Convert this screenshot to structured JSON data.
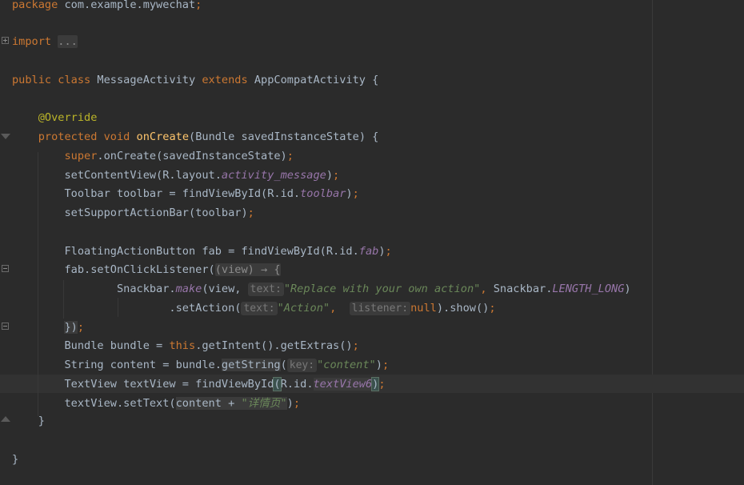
{
  "editor": {
    "lines": {
      "package": {
        "kw": "package",
        "name": "com.example.mywechat",
        "semi": ";"
      },
      "import": {
        "kw": "import",
        "folded": "..."
      },
      "class_decl": {
        "public": "public",
        "class": "class",
        "name": "MessageActivity",
        "extends": "extends",
        "parent": "AppCompatActivity",
        "brace": "{"
      },
      "override": "@Override",
      "oncreate": {
        "protected": "protected",
        "void": "void",
        "name": "onCreate",
        "params": "(Bundle savedInstanceState) {"
      },
      "super_call": {
        "super": "super",
        "rest": ".onCreate(savedInstanceState)",
        "semi": ";"
      },
      "set_content": {
        "a": "setContentView(R.layout.",
        "field": "activity_message",
        "b": ")",
        "semi": ";"
      },
      "toolbar": {
        "a": "Toolbar toolbar = findViewById(R.id.",
        "field": "toolbar",
        "b": ")",
        "semi": ";"
      },
      "support_bar": {
        "a": "setSupportActionBar(toolbar)",
        "semi": ";"
      },
      "fab": {
        "a": "FloatingActionButton fab = findViewById(R.id.",
        "field": "fab",
        "b": ")",
        "semi": ";"
      },
      "listener": {
        "a": "fab.setOnClickListener(",
        "lambda": "(view) → {"
      },
      "snackbar": {
        "a": "Snackbar.",
        "make": "make",
        "b": "(view, ",
        "hint": "text:",
        "str": "\"Replace with your own action\"",
        "comma": ",",
        "c": " Snackbar.",
        "field": "LENGTH_LONG",
        "d": ")"
      },
      "set_action": {
        "a": ".setAction(",
        "hint1": "text:",
        "str": "\"Action\"",
        "comma": ",",
        "hint2": "listener:",
        "null": "null",
        "b": ").show()",
        "semi": ";"
      },
      "close_listener": {
        "a": "})",
        "semi": ";"
      },
      "bundle": {
        "a": "Bundle bundle = ",
        "this": "this",
        "b": ".getIntent().getExtras()",
        "semi": ";"
      },
      "content": {
        "a": "String content = bundle.",
        "method": "getString",
        "b": "(",
        "hint": "key:",
        "str": "\"content\"",
        "c": ")",
        "semi": ";"
      },
      "textview": {
        "a": "TextView textView = findViewById",
        "paren": "(",
        "b": "R.id.",
        "field": "textView6",
        "close": ")",
        "semi": ";"
      },
      "settext": {
        "a": "textView.setText(",
        "expr": "content + ",
        "str": "\"详情页\"",
        "b": ")",
        "semi": ";"
      },
      "close_method": "}",
      "close_class": "}"
    }
  }
}
